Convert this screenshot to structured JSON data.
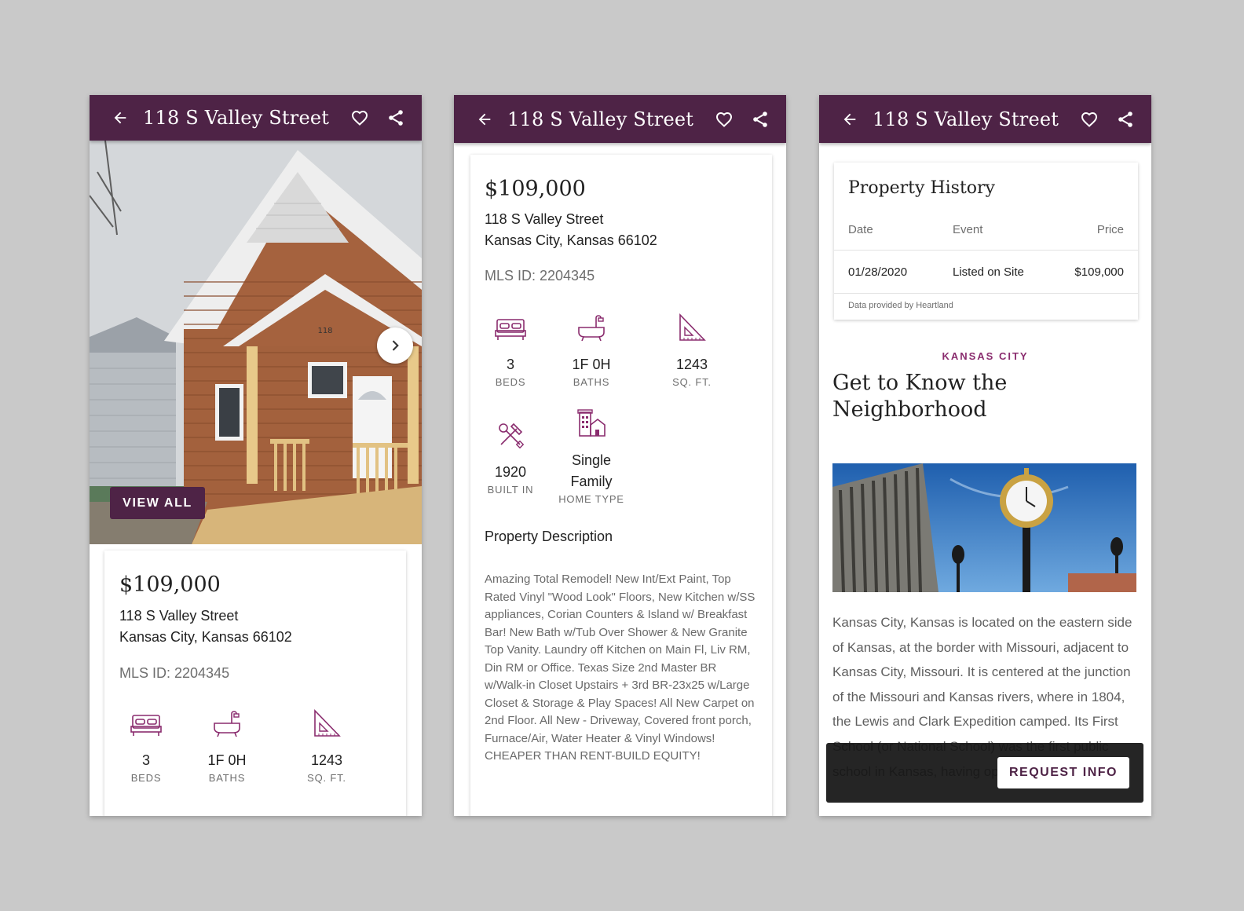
{
  "colors": {
    "primary": "#4e2346",
    "accent": "#8a2c6e",
    "background": "#c9c9c9"
  },
  "appbar": {
    "title": "118 S Valley Street",
    "back_icon": "arrow-left-icon",
    "favorite_icon": "heart-outline-icon",
    "share_icon": "share-icon"
  },
  "gallery": {
    "view_all_label": "VIEW ALL",
    "next_icon": "chevron-right-icon",
    "house_number": "118"
  },
  "listing": {
    "price": "$109,000",
    "address_line1": "118 S Valley Street",
    "address_line2": "Kansas City, Kansas 66102",
    "mls": "MLS ID: 2204345",
    "stats": {
      "beds": {
        "value": "3",
        "label": "BEDS",
        "icon": "bed-icon"
      },
      "baths": {
        "value": "1F 0H",
        "label": "BATHS",
        "icon": "bathtub-icon"
      },
      "sqft": {
        "value": "1243",
        "label": "SQ. FT.",
        "icon": "set-square-icon"
      },
      "built": {
        "value": "1920",
        "label": "BUILT IN",
        "icon": "hammer-wrench-icon"
      },
      "home_type": {
        "value_line1": "Single",
        "value_line2": "Family",
        "label": "HOME TYPE",
        "icon": "buildings-icon"
      }
    }
  },
  "description": {
    "title": "Property Description",
    "text": "Amazing Total Remodel! New Int/Ext Paint, Top Rated Vinyl \"Wood Look\" Floors, New Kitchen w/SS appliances, Corian Counters & Island w/ Breakfast Bar! New Bath w/Tub Over Shower & New Granite Top Vanity. Laundry off Kitchen on Main Fl, Liv RM, Din RM or Office. Texas Size 2nd Master BR w/Walk-in Closet Upstairs + 3rd BR-23x25 w/Large Closet & Storage & Play Spaces! All New Carpet on 2nd Floor. All New - Driveway, Covered front porch, Furnace/Air, Water Heater & Vinyl Windows! CHEAPER THAN RENT-BUILD EQUITY!"
  },
  "history": {
    "title": "Property History",
    "columns": [
      "Date",
      "Event",
      "Price"
    ],
    "rows": [
      {
        "date": "01/28/2020",
        "event": "Listed on Site",
        "price": "$109,000"
      }
    ],
    "footer": "Data provided by Heartland"
  },
  "neighborhood": {
    "label": "KANSAS CITY",
    "title_line1": "Get to Know the",
    "title_line2": "Neighborhood",
    "text": "Kansas City, Kansas is located on the eastern side of Kansas, at the border with Missouri, adjacent to Kansas City, Missouri. It is centered at the junction of the Missouri and Kansas rivers, where in 1804, the Lewis and Clark Expedition camped. Its First School (or National School) was the first public school in Kansas, having opened in"
  },
  "request": {
    "label": "REQUEST INFO"
  }
}
